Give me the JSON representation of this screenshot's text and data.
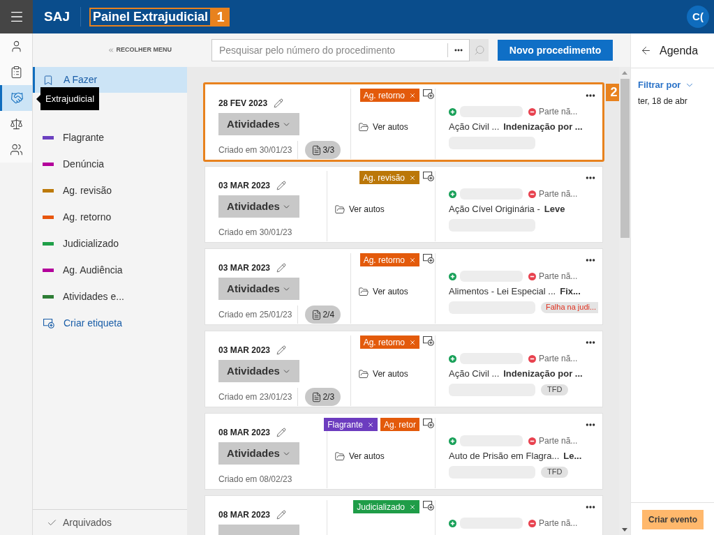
{
  "header": {
    "app_name": "SAJ",
    "title": "Painel Extrajudicial",
    "title_callout": "1",
    "avatar": "C("
  },
  "rail": [
    {
      "selected": false
    },
    {
      "selected": false
    },
    {
      "selected": true
    },
    {
      "selected": false
    },
    {
      "selected": false
    }
  ],
  "tooltip": {
    "text": "Extrajudicial"
  },
  "sidebar": {
    "collapse": "RECOLHER MENU",
    "views": [
      {
        "label": "A Fazer",
        "selected": true
      }
    ],
    "tags": [
      {
        "label": "Flagrante",
        "color": "#6b40c0"
      },
      {
        "label": "Denúncia",
        "color": "#b3009b"
      },
      {
        "label": "Ag. revisão",
        "color": "#bd7a0a"
      },
      {
        "label": "Ag. retorno",
        "color": "#e8560e"
      },
      {
        "label": "Judicializado",
        "color": "#1f9f48"
      },
      {
        "label": "Ag. Audiência",
        "color": "#b3009b"
      },
      {
        "label": "Atividades e...",
        "color": "#2d7d35"
      }
    ],
    "create_tag": "Criar etiqueta",
    "archived": "Arquivados"
  },
  "toolbar": {
    "search": {
      "placeholder": "Pesquisar pelo número do procedimento"
    },
    "new_button": "Novo procedimento"
  },
  "cards": [
    {
      "highlighted": true,
      "callout": "2",
      "date": "28 FEV 2023",
      "activities": "Atividades",
      "created": "Criado em 30/01/23",
      "pages": "3/3",
      "tags": [
        {
          "label": "Ag. retorno",
          "color": "#e35a0b",
          "removable": true
        }
      ],
      "link": "Ver autos",
      "party": "Parte nã...",
      "case_class": "Ação Civil ...",
      "case_subject": "Indenização por ..."
    },
    {
      "highlighted": false,
      "date": "03 MAR 2023",
      "activities": "Atividades",
      "created": "Criado em 30/01/23",
      "tags": [
        {
          "label": "Ag. revisão",
          "color": "#bb7708",
          "removable": true
        }
      ],
      "link": "Ver autos",
      "party": "Parte nã...",
      "case_class": "Ação Cível Originária -",
      "case_subject": "Leve"
    },
    {
      "highlighted": false,
      "date": "03 MAR 2023",
      "activities": "Atividades",
      "created": "Criado em 25/01/23",
      "pages": "2/4",
      "tags": [
        {
          "label": "Ag. retorno",
          "color": "#e35a0b",
          "removable": true
        }
      ],
      "link": "Ver autos",
      "party": "Parte nã...",
      "case_class": "Alimentos - Lei Especial ...",
      "case_subject": "Fix...",
      "flag": {
        "text": "Falha na judi...",
        "kind": "error"
      }
    },
    {
      "highlighted": false,
      "date": "03 MAR 2023",
      "activities": "Atividades",
      "created": "Criado em 23/01/23",
      "pages": "2/3",
      "tags": [
        {
          "label": "Ag. retorno",
          "color": "#e35a0b",
          "removable": true
        }
      ],
      "link": "Ver autos",
      "party": "Parte nã...",
      "case_class": "Ação Civil ...",
      "case_subject": "Indenização por ...",
      "flag": {
        "text": "TFD",
        "kind": "neutral"
      }
    },
    {
      "highlighted": false,
      "date": "08 MAR 2023",
      "activities": "Atividades",
      "created": "Criado em 08/02/23",
      "tags": [
        {
          "label": "Flagrante",
          "color": "#6c3cbf",
          "removable": true
        },
        {
          "label": "Ag. retor",
          "color": "#e35a0b",
          "removable": false
        }
      ],
      "link": "Ver autos",
      "party": "Parte nã...",
      "case_class": "Auto de Prisão em Flagra...",
      "case_subject": "Le...",
      "flag": {
        "text": "TFD",
        "kind": "neutral"
      }
    },
    {
      "highlighted": false,
      "date": "08 MAR 2023",
      "tags": [
        {
          "label": "Judicializado",
          "color": "#1f9d48",
          "removable": true
        }
      ],
      "party": "Parte nã..."
    }
  ],
  "agenda": {
    "title": "Agenda",
    "filter": "Filtrar por",
    "date": "ter, 18 de abr",
    "create_button": "Criar evento"
  }
}
